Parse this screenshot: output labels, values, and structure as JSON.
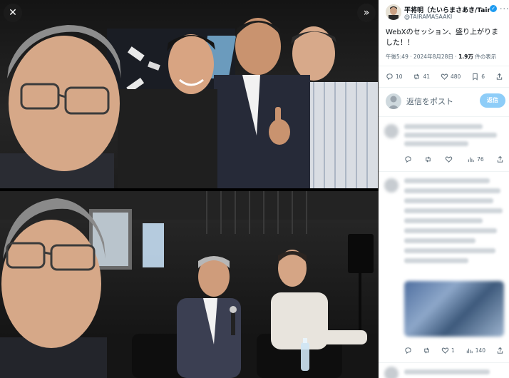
{
  "viewer": {
    "close_icon": "close-icon",
    "expand_icon": "double-chevron-right-icon"
  },
  "tweet": {
    "author_name": "平将明（たいらまさあき/Taira",
    "author_handle": "@TAIRAMASAAKI",
    "verified_icon": "verified-badge-icon",
    "more_icon": "more-horizontal-icon",
    "text": "WebXのセッション、盛り上がりました！！",
    "time": "午後5:49 · 2024年8月28日 · ",
    "views_count": "1.9万",
    "views_label": " 件の表示",
    "actions": {
      "replies": "10",
      "reposts": "41",
      "likes": "480",
      "bookmarks": "6"
    }
  },
  "reply": {
    "placeholder": "返信をポスト",
    "submit_label": "返信"
  },
  "replies": [
    {
      "likes": "",
      "views": "76"
    },
    {
      "likes": "1",
      "views": "140"
    }
  ],
  "colors": {
    "accent": "#1d9bf0",
    "reply_button": "#8ecdf8",
    "muted_text": "#536471"
  }
}
